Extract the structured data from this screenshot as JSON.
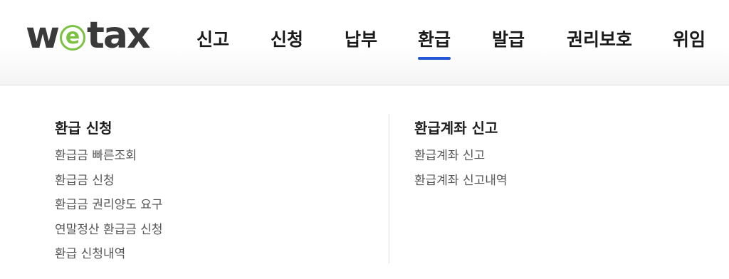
{
  "logo": {
    "before": "w",
    "mark": "e",
    "after": "tax"
  },
  "nav": {
    "items": [
      {
        "label": "신고"
      },
      {
        "label": "신청"
      },
      {
        "label": "납부"
      },
      {
        "label": "환급"
      },
      {
        "label": "발급"
      },
      {
        "label": "권리보호"
      },
      {
        "label": "위임"
      }
    ],
    "active": "환급"
  },
  "menu": {
    "left": {
      "title": "환급 신청",
      "items": [
        "환급금 빠른조회",
        "환급금 신청",
        "환급금 권리양도 요구",
        "연말정산 환급금 신청",
        "환급 신청내역"
      ]
    },
    "right": {
      "title": "환급계좌 신고",
      "items": [
        "환급계좌 신고",
        "환급계좌 신고내역"
      ]
    }
  },
  "colors": {
    "accent": "#2356d6",
    "logo_green": "#7cc242",
    "logo_gray": "#3a3a3a"
  }
}
